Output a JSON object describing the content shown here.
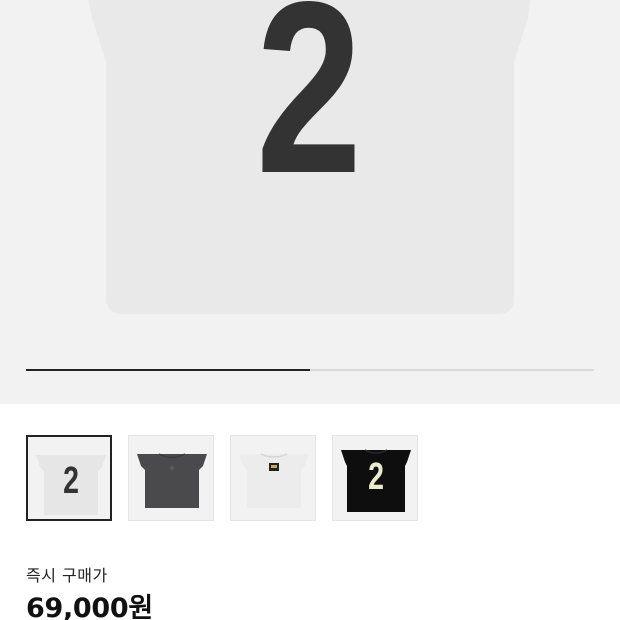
{
  "hero": {
    "product_number": "2",
    "gallery_progress": 0.5
  },
  "thumbnails": [
    {
      "variant": "white-front-number",
      "number": "2",
      "selected": true
    },
    {
      "variant": "charcoal-back",
      "selected": false
    },
    {
      "variant": "white-back-logo",
      "selected": false
    },
    {
      "variant": "black-front-number",
      "number": "2",
      "selected": false
    }
  ],
  "purchase": {
    "instant_buy_label": "즉시 구매가",
    "price": "69,000원"
  },
  "colors": {
    "hero_background": "#f2f2f2",
    "shirt_white": "#e9e9e9",
    "number_dark": "#333333",
    "shirt_charcoal": "#4a4a4c",
    "shirt_black": "#0e0e0e",
    "number_cream": "#e9ecc9"
  }
}
